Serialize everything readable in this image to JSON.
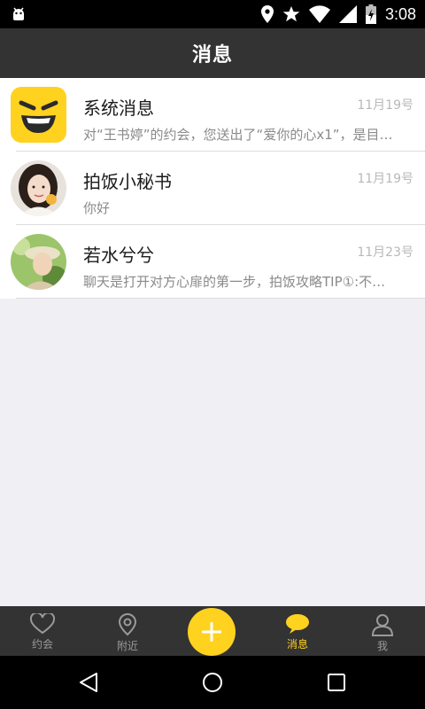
{
  "status_bar": {
    "time": "3:08"
  },
  "header": {
    "title": "消息"
  },
  "messages": [
    {
      "name": "系统消息",
      "date": "11月19号",
      "preview": "对“王书婷”的约会，您送出了“爱你的心x1”，是目…",
      "avatar": "smiley-logo"
    },
    {
      "name": "拍饭小秘书",
      "date": "11月19号",
      "preview": "你好",
      "avatar": "girl-photo"
    },
    {
      "name": "若水兮兮",
      "date": "11月23号",
      "preview": "聊天是打开对方心扉的第一步，拍饭攻略TIP①:不…",
      "avatar": "hat-girl-photo"
    }
  ],
  "tabs": [
    {
      "label": "约会",
      "icon": "heart-icon"
    },
    {
      "label": "附近",
      "icon": "location-pin-icon"
    },
    {
      "label": "",
      "icon": "plus-icon"
    },
    {
      "label": "消息",
      "icon": "chat-bubble-icon",
      "active": true
    },
    {
      "label": "我",
      "icon": "person-icon"
    }
  ],
  "colors": {
    "accent": "#ffd21f",
    "bar": "#333333",
    "background": "#efeff4"
  }
}
